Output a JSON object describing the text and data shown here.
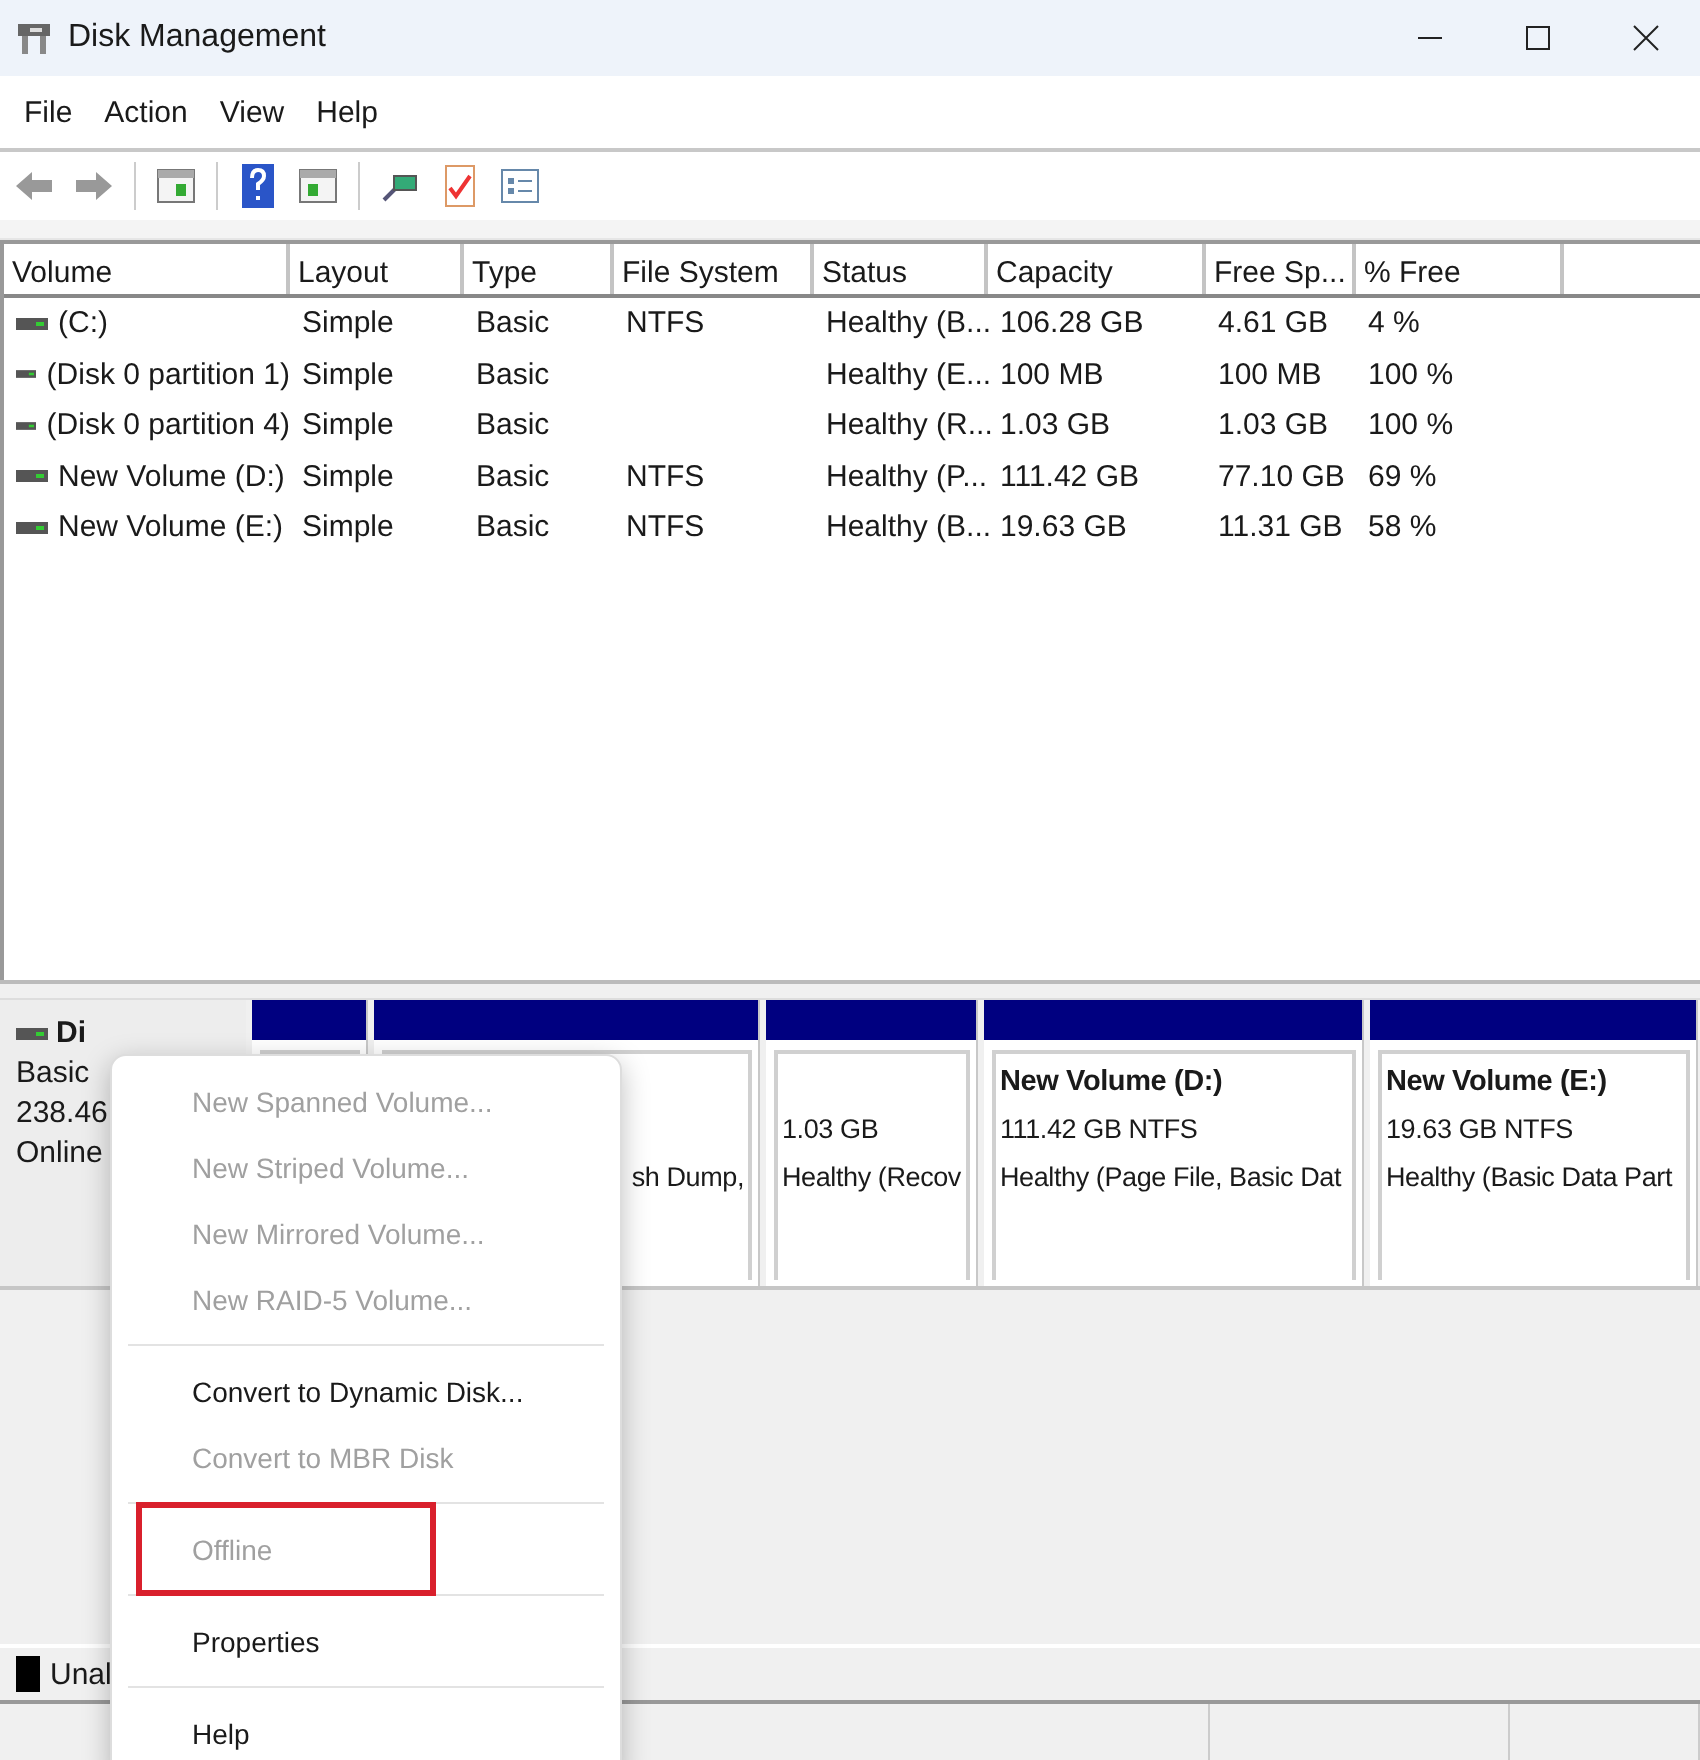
{
  "window": {
    "title": "Disk Management"
  },
  "menu_bar": [
    "File",
    "Action",
    "View",
    "Help"
  ],
  "table": {
    "columns": [
      "Volume",
      "Layout",
      "Type",
      "File System",
      "Status",
      "Capacity",
      "Free Sp...",
      "% Free"
    ],
    "rows": [
      [
        "(C:)",
        "Simple",
        "Basic",
        "NTFS",
        "Healthy (B...",
        "106.28 GB",
        "4.61 GB",
        "4 %"
      ],
      [
        "(Disk 0 partition 1)",
        "Simple",
        "Basic",
        "",
        "Healthy (E...",
        "100 MB",
        "100 MB",
        "100 %"
      ],
      [
        "(Disk 0 partition 4)",
        "Simple",
        "Basic",
        "",
        "Healthy (R...",
        "1.03 GB",
        "1.03 GB",
        "100 %"
      ],
      [
        "New Volume (D:)",
        "Simple",
        "Basic",
        "NTFS",
        "Healthy (P...",
        "111.42 GB",
        "77.10 GB",
        "69 %"
      ],
      [
        "New Volume (E:)",
        "Simple",
        "Basic",
        "NTFS",
        "Healthy (B...",
        "19.63 GB",
        "11.31 GB",
        "58 %"
      ]
    ]
  },
  "disk": {
    "name": "Di",
    "type": "Basic",
    "size": "238.46",
    "state": "Online",
    "partitions": [
      {
        "kind": "covered"
      },
      {
        "kind": "volume",
        "status": "sh Dump,"
      },
      {
        "kind": "volume",
        "size": "1.03 GB",
        "status": "Healthy (Recov"
      },
      {
        "kind": "volume",
        "name": "New Volume  (D:)",
        "size": "111.42 GB NTFS",
        "status": "Healthy (Page File, Basic Dat"
      },
      {
        "kind": "volume",
        "name": "New Volume  (E:)",
        "size": "19.63 GB NTFS",
        "status": "Healthy (Basic Data Part"
      }
    ]
  },
  "legend": [
    {
      "label": "Unal",
      "color": "#000000"
    }
  ],
  "context_menu": [
    {
      "kind": "item",
      "label": "New Spanned Volume...",
      "disabled": true,
      "highlighted": false
    },
    {
      "kind": "item",
      "label": "New Striped Volume...",
      "disabled": true,
      "highlighted": false
    },
    {
      "kind": "item",
      "label": "New Mirrored Volume...",
      "disabled": true,
      "highlighted": false
    },
    {
      "kind": "item",
      "label": "New RAID-5 Volume...",
      "disabled": true,
      "highlighted": false
    },
    {
      "kind": "separator"
    },
    {
      "kind": "item",
      "label": "Convert to Dynamic Disk...",
      "disabled": false,
      "highlighted": false
    },
    {
      "kind": "item",
      "label": "Convert to MBR Disk",
      "disabled": true,
      "highlighted": false
    },
    {
      "kind": "separator"
    },
    {
      "kind": "item",
      "label": "Offline",
      "disabled": true,
      "highlighted": true
    },
    {
      "kind": "separator"
    },
    {
      "kind": "item",
      "label": "Properties",
      "disabled": false,
      "highlighted": false
    },
    {
      "kind": "separator"
    },
    {
      "kind": "item",
      "label": "Help",
      "disabled": false,
      "highlighted": false
    }
  ]
}
